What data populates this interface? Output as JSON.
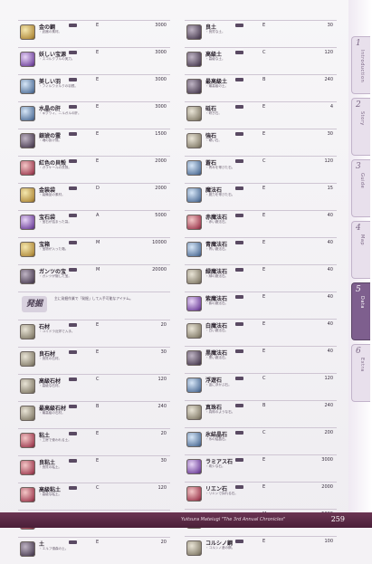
{
  "left_column": [
    {
      "name": "金の鋼",
      "rank": "E",
      "price": "3000",
      "desc": "・武器の素材。",
      "icon": "gold"
    },
    {
      "name": "妖しい宝源",
      "rank": "E",
      "price": "3000",
      "desc": "・スコルクブルの実力。",
      "icon": "purp"
    },
    {
      "name": "美しい羽",
      "rank": "E",
      "price": "3000",
      "desc": "・フィルウォルクの羽根。",
      "icon": "blue"
    },
    {
      "name": "水晶の肝",
      "rank": "E",
      "price": "3000",
      "desc": "・キグウィ、ニルガルの肝。",
      "icon": "blue"
    },
    {
      "name": "銀琥の霊",
      "rank": "E",
      "price": "1500",
      "desc": "・魂の抜け殻。",
      "icon": "dark"
    },
    {
      "name": "紅色の貝殻",
      "rank": "E",
      "price": "2000",
      "desc": "・ガラケールの貝殻。",
      "icon": "red"
    },
    {
      "name": "金装袋",
      "rank": "D",
      "price": "2000",
      "desc": "・装備品の素材。",
      "icon": "gold"
    },
    {
      "name": "宝石袋",
      "rank": "A",
      "price": "5000",
      "desc": "・宝石が詰まった袋。",
      "icon": "purp"
    },
    {
      "name": "宝箱",
      "rank": "M",
      "price": "10000",
      "desc": "・宝物が入った箱。",
      "icon": "gold"
    },
    {
      "name": "ガンツの宝",
      "rank": "M",
      "price": "20000",
      "desc": "・ガンツが隠した宝。",
      "icon": "dark"
    },
    {
      "section": true,
      "label": "発掘",
      "note": "主に発掘作業で「発掘」して入手可能なアイテム。"
    },
    {
      "name": "石材",
      "rank": "E",
      "price": "20",
      "desc": "・ユイドラ近郊で入手。",
      "icon": ""
    },
    {
      "name": "良石材",
      "rank": "E",
      "price": "30",
      "desc": "・良質の石材。",
      "icon": ""
    },
    {
      "name": "高級石材",
      "rank": "C",
      "price": "120",
      "desc": "・高級な石材。",
      "icon": ""
    },
    {
      "name": "最高級石材",
      "rank": "B",
      "price": "240",
      "desc": "・最高級の石材。",
      "icon": ""
    },
    {
      "name": "粘土",
      "rank": "E",
      "price": "20",
      "desc": "・工房で使われる土。",
      "icon": "red"
    },
    {
      "name": "良粘土",
      "rank": "E",
      "price": "30",
      "desc": "・良質の粘土。",
      "icon": "red"
    },
    {
      "name": "高級粘土",
      "rank": "C",
      "price": "120",
      "desc": "・高級な粘土。",
      "icon": "red"
    },
    {
      "name": "最高級粘土",
      "rank": "B",
      "price": "240",
      "desc": "・最高級の粘土。",
      "icon": "red"
    },
    {
      "name": "土",
      "rank": "E",
      "price": "20",
      "desc": "・エルフ領森の土。",
      "icon": "dark"
    }
  ],
  "right_column": [
    {
      "name": "良土",
      "rank": "E",
      "price": "30",
      "desc": "・良質な土。",
      "icon": "dark"
    },
    {
      "name": "高級土",
      "rank": "C",
      "price": "120",
      "desc": "・高級な土。",
      "icon": "dark"
    },
    {
      "name": "最高級土",
      "rank": "B",
      "price": "240",
      "desc": "・最高級の土。",
      "icon": "dark"
    },
    {
      "name": "砥石",
      "rank": "E",
      "price": "4",
      "desc": "・研ぎ石。",
      "icon": ""
    },
    {
      "name": "強石",
      "rank": "E",
      "price": "30",
      "desc": "・硬い石。",
      "icon": ""
    },
    {
      "name": "蒼石",
      "rank": "C",
      "price": "120",
      "desc": "・青みを帯びた石。",
      "icon": "blue"
    },
    {
      "name": "魔法石",
      "rank": "E",
      "price": "15",
      "desc": "・魔力を帯びた石。",
      "icon": "blue"
    },
    {
      "name": "赤魔法石",
      "rank": "E",
      "price": "40",
      "desc": "・赤い魔法石。",
      "icon": "red"
    },
    {
      "name": "青魔法石",
      "rank": "E",
      "price": "40",
      "desc": "・青い魔法石。",
      "icon": "blue"
    },
    {
      "name": "緑魔法石",
      "rank": "E",
      "price": "40",
      "desc": "・緑の魔法石。",
      "icon": ""
    },
    {
      "name": "紫魔法石",
      "rank": "E",
      "price": "40",
      "desc": "・紫の魔法石。",
      "icon": "purp"
    },
    {
      "name": "白魔法石",
      "rank": "E",
      "price": "40",
      "desc": "・白い魔法石。",
      "icon": ""
    },
    {
      "name": "黒魔法石",
      "rank": "E",
      "price": "40",
      "desc": "・黒い魔法石。",
      "icon": "dark"
    },
    {
      "name": "浮遊石",
      "rank": "C",
      "price": "120",
      "desc": "・宙に浮かぶ石。",
      "icon": "blue"
    },
    {
      "name": "真珠石",
      "rank": "B",
      "price": "240",
      "desc": "・真珠のような石。",
      "icon": ""
    },
    {
      "name": "氷結晶石",
      "rank": "C",
      "price": "200",
      "desc": "・氷の結晶石。",
      "icon": "blue"
    },
    {
      "name": "ラミアス石",
      "rank": "E",
      "price": "3000",
      "desc": "・希少な石。",
      "icon": "purp"
    },
    {
      "name": "リエン石",
      "rank": "E",
      "price": "2000",
      "desc": "・リエンで採れる石。",
      "icon": "red"
    },
    {
      "name": "金剛石",
      "rank": "M",
      "price": "5000",
      "desc": "・非常に硬い石。",
      "icon": "gold"
    },
    {
      "name": "コルシノ鋼",
      "rank": "E",
      "price": "100",
      "desc": "・コルシノ産の鋼。",
      "icon": ""
    }
  ],
  "sidebar": {
    "tabs": [
      {
        "num": "1",
        "label": "Introduction"
      },
      {
        "num": "2",
        "label": "Story"
      },
      {
        "num": "3",
        "label": "Guide"
      },
      {
        "num": "4",
        "label": "Map"
      },
      {
        "num": "5",
        "label": "Data"
      },
      {
        "num": "6",
        "label": "Extra"
      }
    ],
    "active_index": 4
  },
  "footer": {
    "text": "Yuitsura Mateiugi \"The 3rd Annual Chronicles\"",
    "page": "259"
  }
}
